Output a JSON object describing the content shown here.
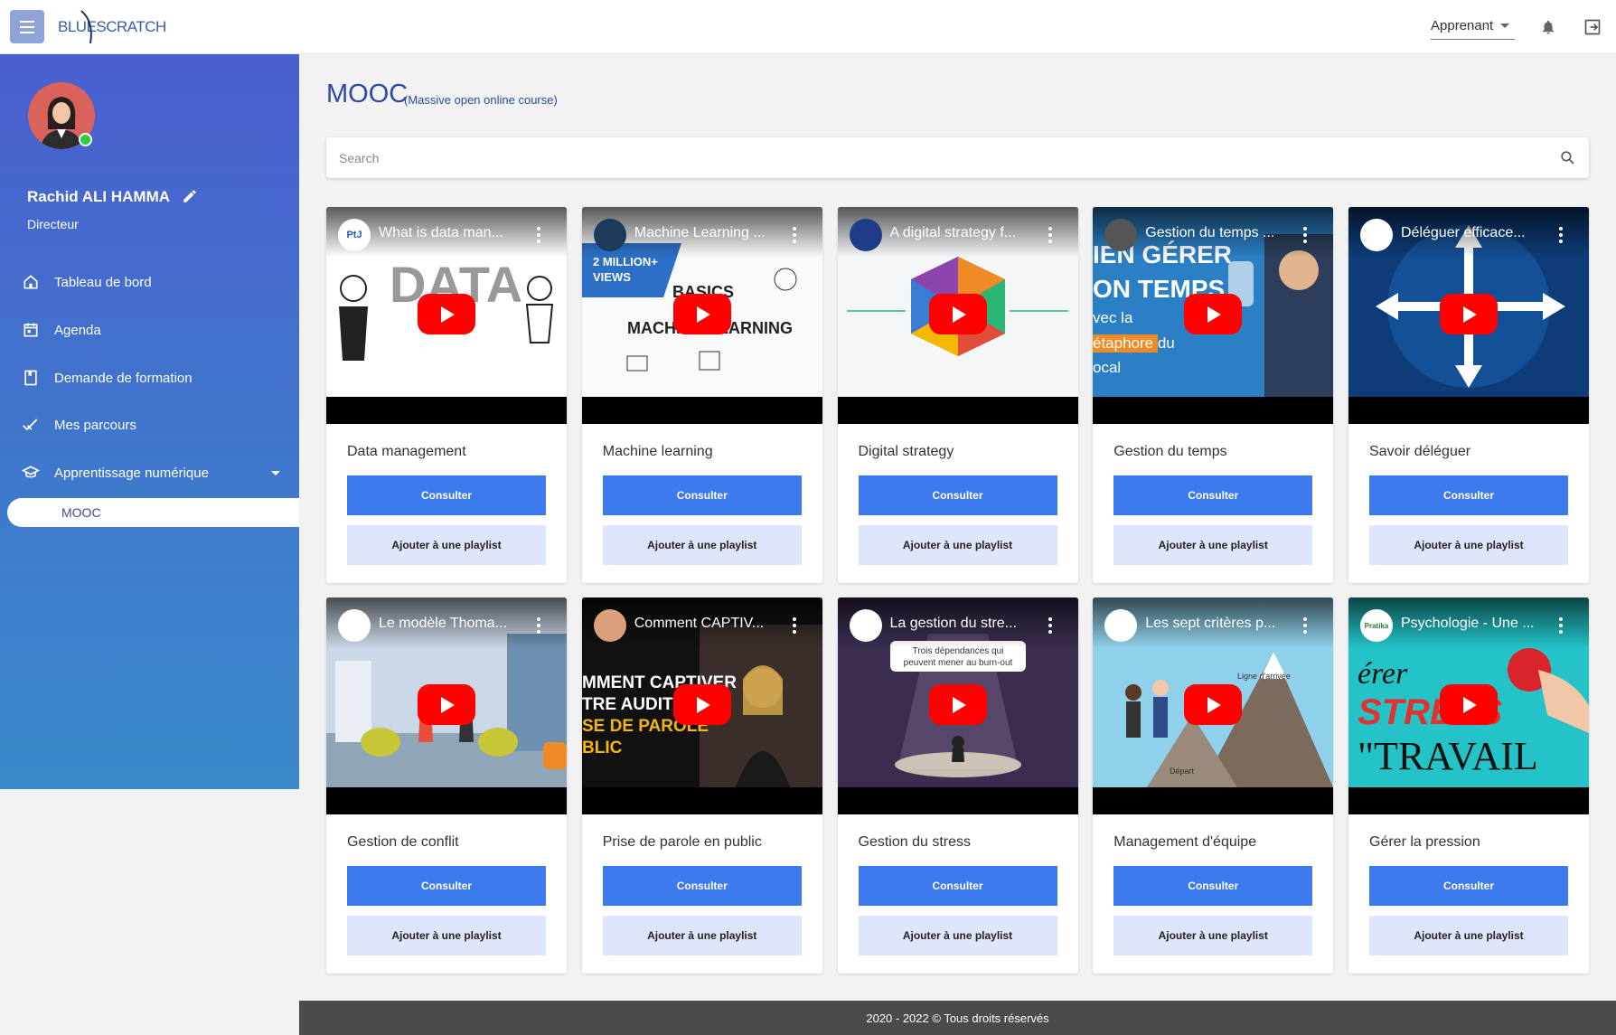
{
  "app": {
    "logo_text": "BLUESCRATCH",
    "role_select": "Apprenant"
  },
  "sidebar": {
    "user_name": "Rachid ALI HAMMA",
    "user_role": "Directeur",
    "items": [
      {
        "label": "Tableau de bord",
        "icon": "home-icon"
      },
      {
        "label": "Agenda",
        "icon": "calendar-icon"
      },
      {
        "label": "Demande de formation",
        "icon": "bookmark-icon"
      },
      {
        "label": "Mes parcours",
        "icon": "double-check-icon"
      },
      {
        "label": "Apprentissage numérique",
        "icon": "graduation-cap-icon"
      }
    ],
    "sub_item": "MOOC"
  },
  "main": {
    "title": "MOOC",
    "subtitle": "(Massive open online course)",
    "search_placeholder": "Search",
    "consult_label": "Consulter",
    "playlist_label": "Ajouter à une playlist",
    "cards": [
      {
        "title": "Data management",
        "video_title": "What is data man...",
        "channel": "PtJ"
      },
      {
        "title": "Machine learning",
        "video_title": "Machine Learning ...",
        "channel": ""
      },
      {
        "title": "Digital strategy",
        "video_title": "A digital strategy f...",
        "channel": ""
      },
      {
        "title": "Gestion du temps",
        "video_title": "Gestion du temps ...",
        "channel": ""
      },
      {
        "title": "Savoir déléguer",
        "video_title": "Déléguer efficace...",
        "channel": ""
      },
      {
        "title": "Gestion de conflit",
        "video_title": "Le modèle Thoma...",
        "channel": ""
      },
      {
        "title": "Prise de parole en public",
        "video_title": "Comment CAPTIV...",
        "channel": ""
      },
      {
        "title": "Gestion du stress",
        "video_title": "La gestion du stre...",
        "channel": ""
      },
      {
        "title": "Management d'équipe",
        "video_title": "Les sept critères p...",
        "channel": ""
      },
      {
        "title": "Gérer la pression",
        "video_title": "Psychologie - Une ...",
        "channel": "Pratika"
      }
    ]
  },
  "footer": {
    "text": "2020 - 2022 © Tous droits réservés"
  }
}
